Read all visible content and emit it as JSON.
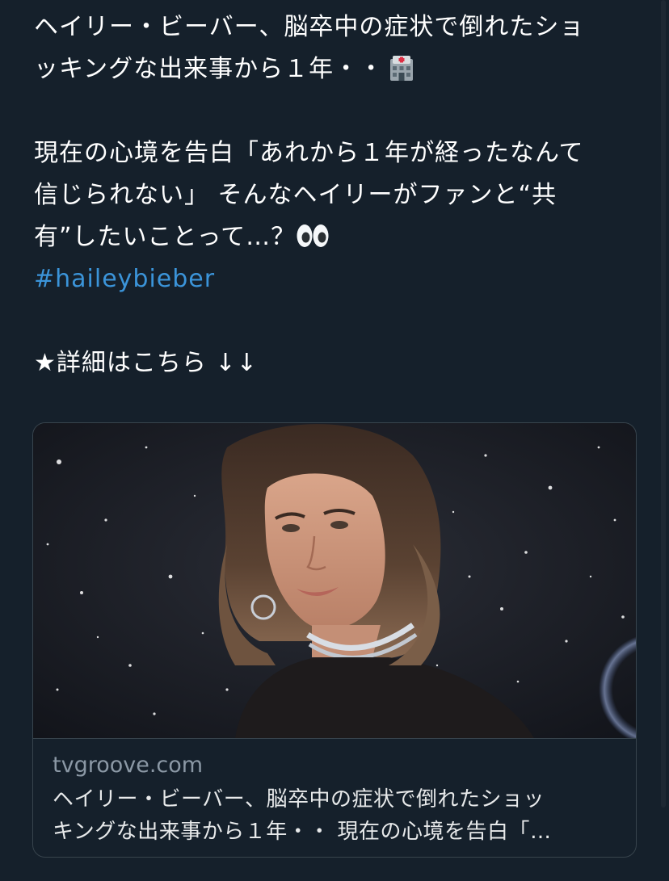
{
  "tweet": {
    "lines": [
      "ヘイリー・ビーバー、脳卒中の症状で倒れたショ",
      "ッキングな出来事から１年・・",
      "現在の心境を告白「あれから１年が経ったなんて",
      "信じられない」 そんなヘイリーがファンと“共",
      "有”したいことって…？"
    ],
    "hashtag": "#haileybieber",
    "details": "★詳細はこちら ↓↓",
    "emojis": [
      "hospital-emoji",
      "eyes-emoji"
    ]
  },
  "card": {
    "domain": "tvgroove.com",
    "title_lines": [
      "ヘイリー・ビーバー、脳卒中の症状で倒れたショッ",
      "キングな出来事から１年・・ 現在の心境を告白「…"
    ]
  },
  "colors": {
    "background": "#15202b",
    "text": "#ffffff",
    "hashtag": "#3b94d9",
    "muted": "#8b98a5",
    "border": "#38444d"
  }
}
